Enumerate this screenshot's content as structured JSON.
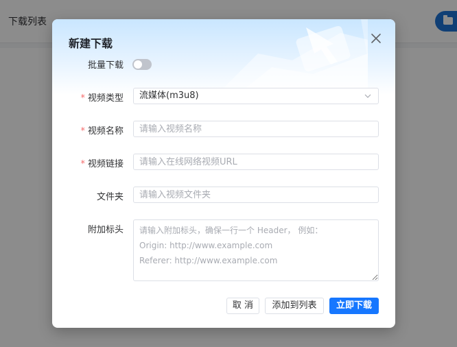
{
  "app": {
    "title": "下载列表"
  },
  "dialog": {
    "title": "新建下载",
    "batch_label": "批量下载",
    "video_type": {
      "label": "视频类型",
      "value": "流媒体(m3u8)"
    },
    "video_name": {
      "label": "视频名称",
      "placeholder": "请输入视频名称"
    },
    "video_url": {
      "label": "视频链接",
      "placeholder": "请输入在线网络视频URL"
    },
    "folder": {
      "label": "文件夹",
      "placeholder": "请输入视频文件夹"
    },
    "headers": {
      "label": "附加标头",
      "placeholder": "请输入附加标头，确保一行一个 Header， 例如：\nOrigin: http://www.example.com\nReferer: http://www.example.com"
    },
    "buttons": {
      "cancel": "取 消",
      "add_to_list": "添加到列表",
      "download_now": "立即下载"
    },
    "required_mark": "*"
  },
  "colors": {
    "primary": "#1677ff",
    "required": "#f56c6c"
  }
}
